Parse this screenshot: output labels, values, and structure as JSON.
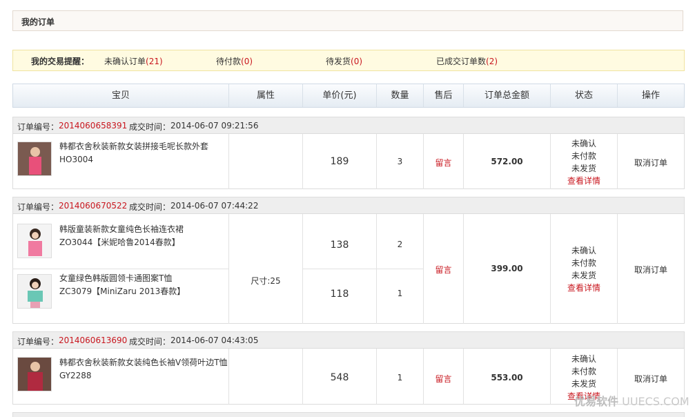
{
  "page_title": "我的订单",
  "alerts": {
    "label": "我的交易提醒：",
    "unconfirmed_label": "未确认订单",
    "unconfirmed_count": "(21)",
    "pending_payment_label": "待付款",
    "pending_payment_count": "(0)",
    "pending_ship_label": "待发货",
    "pending_ship_count": "(0)",
    "completed_label": "已成交订单数",
    "completed_count": "(2)"
  },
  "columns": {
    "product": "宝贝",
    "attr": "属性",
    "price": "单价(元)",
    "qty": "数量",
    "aftersale": "售后",
    "total": "订单总金额",
    "status": "状态",
    "action": "操作"
  },
  "order_no_label": "订单编号：",
  "deal_time_label": "成交时间：",
  "orders": [
    {
      "no": "2014060658391",
      "time": "2014-06-07 09:21:56",
      "items": [
        {
          "name": "韩都衣舍秋装新款女装拼接毛呢长款外套",
          "code": "HO3004",
          "price": "189",
          "qty": "3"
        }
      ],
      "attr": "",
      "aftersale": "留言",
      "total": "572.00",
      "status": [
        "未确认",
        "未付款",
        "未发货"
      ],
      "detail": "查看详情",
      "action": "取消订单"
    },
    {
      "no": "2014060670522",
      "time": "2014-06-07 07:44:22",
      "items": [
        {
          "name": "韩版童装新款女童纯色长袖连衣裙",
          "code": "ZO3044【米妮哈鲁2014春款】",
          "price": "138",
          "qty": "2"
        },
        {
          "name": "女童绿色韩版圆领卡通图案T恤",
          "code": "ZC3079【MiniZaru 2013春款】",
          "price": "118",
          "qty": "1"
        }
      ],
      "attr": "尺寸:25",
      "aftersale": "留言",
      "total": "399.00",
      "status": [
        "未确认",
        "未付款",
        "未发货"
      ],
      "detail": "查看详情",
      "action": "取消订单"
    },
    {
      "no": "2014060613690",
      "time": "2014-06-07 04:43:05",
      "items": [
        {
          "name": "韩都衣舍秋装新款女装纯色长袖V领荷叶边T恤",
          "code": "GY2288",
          "price": "548",
          "qty": "1"
        }
      ],
      "attr": "",
      "aftersale": "留言",
      "total": "553.00",
      "status": [
        "未确认",
        "未付款",
        "未发货"
      ],
      "detail": "查看详情",
      "action": "取消订单"
    }
  ],
  "watermark": {
    "brand": "优易软件",
    "site": "UUECS.COM"
  },
  "colors": {
    "accent_red": "#c8161e",
    "alert_bg": "#fffbe1",
    "header_bg": "#e5ecf3"
  }
}
